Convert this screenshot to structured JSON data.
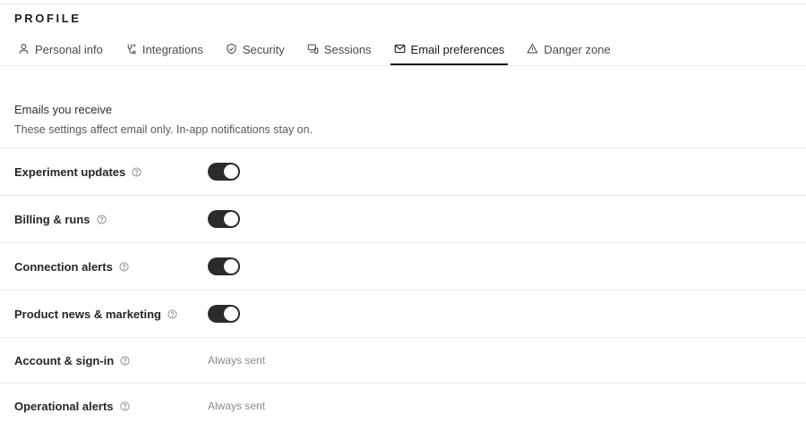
{
  "page": {
    "title": "PROFILE"
  },
  "tabs": [
    {
      "label": "Personal info",
      "icon": "user-icon",
      "active": false
    },
    {
      "label": "Integrations",
      "icon": "integrations-icon",
      "active": false
    },
    {
      "label": "Security",
      "icon": "shield-icon",
      "active": false
    },
    {
      "label": "Sessions",
      "icon": "devices-icon",
      "active": false
    },
    {
      "label": "Email preferences",
      "icon": "mail-icon",
      "active": true
    },
    {
      "label": "Danger zone",
      "icon": "warning-icon",
      "active": false
    }
  ],
  "section": {
    "title": "Emails you receive",
    "subtitle": "These settings affect email only. In-app notifications stay on."
  },
  "preferences": [
    {
      "label": "Experiment updates",
      "enabled": true
    },
    {
      "label": "Billing & runs",
      "enabled": true
    },
    {
      "label": "Connection alerts",
      "enabled": true
    },
    {
      "label": "Product news & marketing",
      "enabled": true
    }
  ],
  "always_sent": [
    {
      "label": "Account & sign-in",
      "value": "Always sent"
    },
    {
      "label": "Operational alerts",
      "value": "Always sent"
    }
  ],
  "colors": {
    "accent": "#2b2b2b",
    "divider": "#ececec",
    "muted": "#8a8a8a"
  }
}
